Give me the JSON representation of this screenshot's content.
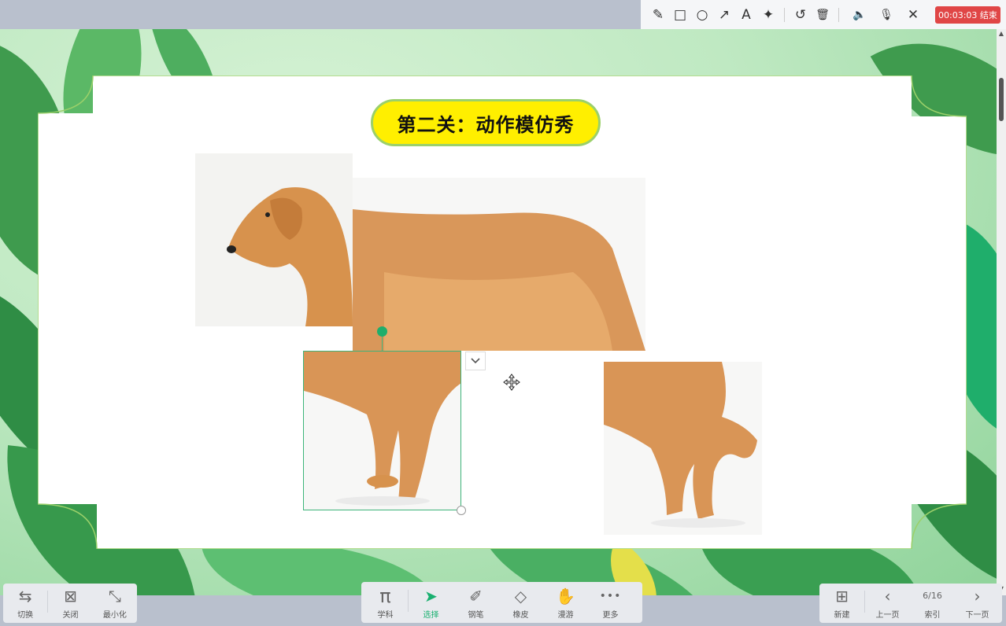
{
  "top_toolbar": {
    "tools": [
      {
        "name": "pen-icon",
        "glyph": "✎"
      },
      {
        "name": "rectangle-icon",
        "glyph": "□"
      },
      {
        "name": "circle-icon",
        "glyph": "○"
      },
      {
        "name": "arrow-icon",
        "glyph": "↗"
      },
      {
        "name": "text-icon",
        "glyph": "A"
      },
      {
        "name": "magic-wand-icon",
        "glyph": "✦"
      },
      {
        "name": "undo-icon",
        "glyph": "↺"
      },
      {
        "name": "trash-icon",
        "glyph": "🗑"
      },
      {
        "name": "speaker-icon",
        "glyph": "🔈"
      },
      {
        "name": "microphone-icon",
        "glyph": "🎙"
      },
      {
        "name": "close-icon",
        "glyph": "✕"
      }
    ],
    "timer": "00:03:03 结束",
    "timer_color": "#e04646"
  },
  "slide": {
    "title": "第二关：动作模仿秀",
    "title_bg": "#ffef00"
  },
  "bottom_left": {
    "buttons": [
      {
        "label": "切换",
        "icon": "switch-icon",
        "glyph": "⇆"
      },
      {
        "label": "关闭",
        "icon": "close-box-icon",
        "glyph": "⊠"
      },
      {
        "label": "最小化",
        "icon": "minimize-icon",
        "glyph": "⤡"
      }
    ]
  },
  "bottom_center": {
    "tools": [
      {
        "label": "学科",
        "icon": "pi-icon",
        "glyph": "π"
      },
      {
        "label": "选择",
        "icon": "select-arrow-icon",
        "glyph": "➤",
        "active": true
      },
      {
        "label": "钢笔",
        "icon": "brush-icon",
        "glyph": "✐"
      },
      {
        "label": "橡皮",
        "icon": "eraser-icon",
        "glyph": "◇"
      },
      {
        "label": "漫游",
        "icon": "hand-icon",
        "glyph": "✋"
      },
      {
        "label": "更多",
        "icon": "more-icon",
        "glyph": "•••"
      }
    ],
    "accent": "#19b070"
  },
  "bottom_right": {
    "new_label": "新建",
    "prev_label": "上一页",
    "page_indicator": "6/16",
    "index_label": "索引",
    "next_label": "下一页"
  }
}
